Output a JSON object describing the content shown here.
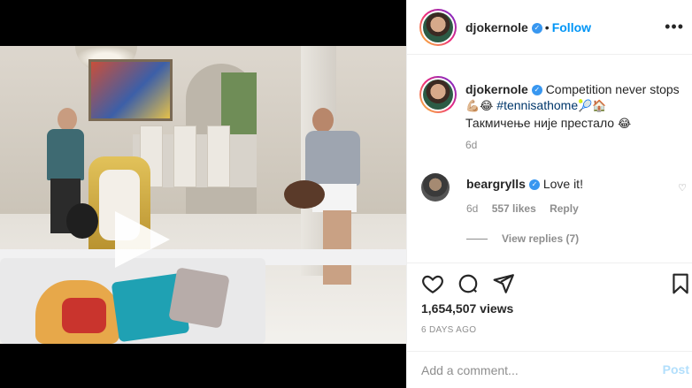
{
  "header": {
    "username": "djokernole",
    "follow_label": "Follow",
    "separator": "•",
    "verified_badge": "verified-badge"
  },
  "caption": {
    "username": "djokernole",
    "text_line1": "Competition never stops",
    "emoji_line2a": "💪🏼😂",
    "hashtag": "#tennisathome",
    "emoji_line2b": "🎾🏠",
    "text_line3": "Такмичење није престало",
    "emoji_line3": "😂",
    "time": "6d"
  },
  "comment": {
    "username": "beargrylls",
    "text": "Love it!",
    "time": "6d",
    "likes": "557 likes",
    "reply_label": "Reply",
    "view_replies": "View replies (7)"
  },
  "actions": {
    "icons": [
      "heart-icon",
      "comment-icon",
      "share-icon",
      "bookmark-icon"
    ]
  },
  "stats": {
    "views": "1,654,507 views",
    "posted_ago": "6 DAYS AGO"
  },
  "composer": {
    "placeholder": "Add a comment...",
    "post_label": "Post"
  },
  "colors": {
    "link_blue": "#0095f6",
    "post_disabled": "#b2dffc",
    "muted_text": "#8e8e8e"
  }
}
